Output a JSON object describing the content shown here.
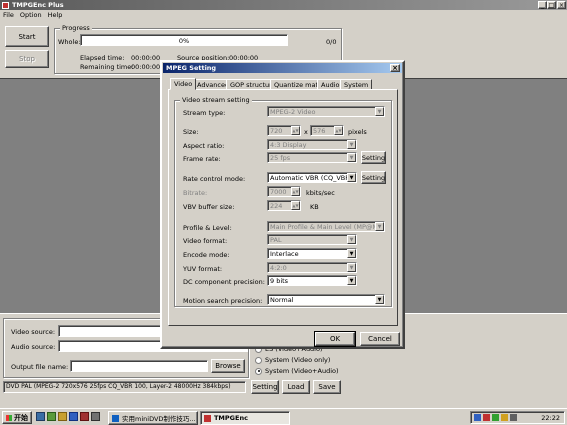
{
  "app": {
    "title": "TMPGEnc Plus",
    "menu": [
      "File",
      "Option",
      "Help"
    ],
    "win_controls": [
      "_",
      "□",
      "×"
    ]
  },
  "main": {
    "start_label": "Start",
    "stop_label": "Stop",
    "progress_title": "Progress",
    "whole_label": "Whole:",
    "progress_text": "0%",
    "progress_count": "0/0",
    "progress_fraction": 0,
    "elapsed_label": "Elapsed time:",
    "elapsed_value": "00:00:00",
    "remaining_label": "Remaining time:",
    "remaining_value": "00:00:00",
    "source_pos_label": "Source position:",
    "source_pos_value": "00:00:00",
    "video_source_label": "Video source:",
    "audio_source_label": "Audio source:",
    "output_label": "Output file name:",
    "browse_label": "Browse",
    "status_text": "DVD PAL (MPEG-2 720x576 25fps CQ_VBR 100,  Layer-2 48000Hz 384kbps)",
    "setting_label": "Setting",
    "load_label": "Load",
    "save_label": "Save",
    "stream_options": [
      "ES (Video+Audio)",
      "System (Video only)",
      "System (Video+Audio)"
    ]
  },
  "dialog": {
    "title": "MPEG Setting",
    "close": "×",
    "tabs": [
      "Video",
      "Advanced",
      "GOP structure",
      "Quantize matrix",
      "Audio",
      "System"
    ],
    "group_title": "Video stream setting",
    "stream_type_label": "Stream type:",
    "stream_type_value": "MPEG-2 Video",
    "size_label": "Size:",
    "size_w": "720",
    "size_x": "x",
    "size_h": "576",
    "size_unit": "pixels",
    "aspect_label": "Aspect ratio:",
    "aspect_value": "4:3 Display",
    "frame_rate_label": "Frame rate:",
    "frame_rate_value": "25 fps",
    "frame_setting": "Setting",
    "rate_control_label": "Rate control mode:",
    "rate_control_value": "Automatic VBR (CQ_VBR)",
    "rate_setting": "Setting",
    "bitrate_label": "Bitrate:",
    "bitrate_value": "7000",
    "bitrate_unit": "kbits/sec",
    "vbv_label": "VBV buffer size:",
    "vbv_value": "224",
    "vbv_unit": "KB",
    "profile_label": "Profile & Level:",
    "profile_value": "Main Profile & Main Level (MP@ML)",
    "video_format_label": "Video format:",
    "video_format_value": "PAL",
    "encode_mode_label": "Encode mode:",
    "encode_mode_value": "Interlace",
    "yuv_label": "YUV format:",
    "yuv_value": "4:2:0",
    "dc_label": "DC component precision:",
    "dc_value": "9 bits",
    "motion_label": "Motion search precision:",
    "motion_value": "Normal",
    "ok_label": "OK",
    "cancel_label": "Cancel"
  },
  "taskbar": {
    "start_label": "开始",
    "tasks": [
      "实用miniDVD制作技巧...",
      "TMPGEnc"
    ],
    "clock": "22:22"
  }
}
